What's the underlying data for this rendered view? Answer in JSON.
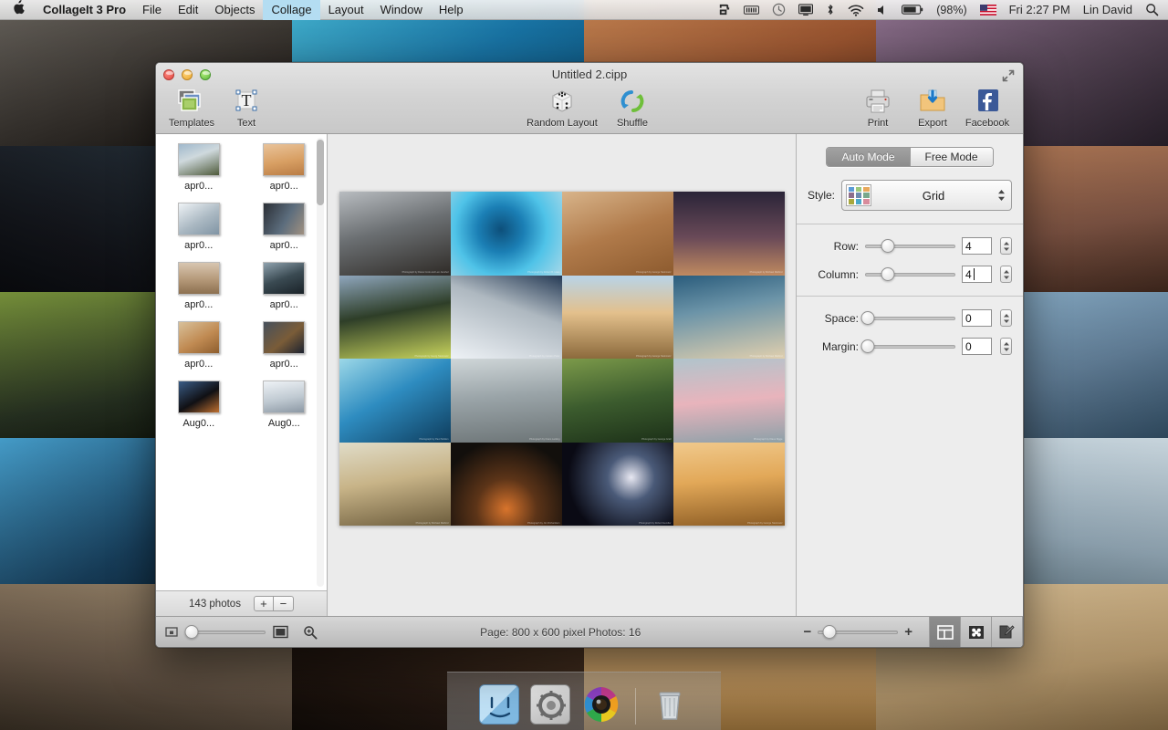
{
  "menubar": {
    "apple_icon": "apple-logo-icon",
    "app_name": "CollageIt 3 Pro",
    "menus": [
      {
        "label": "File",
        "active": false
      },
      {
        "label": "Edit",
        "active": false
      },
      {
        "label": "Objects",
        "active": false
      },
      {
        "label": "Collage",
        "active": true
      },
      {
        "label": "Layout",
        "active": false
      },
      {
        "label": "Window",
        "active": false
      },
      {
        "label": "Help",
        "active": false
      }
    ],
    "status": {
      "icons": [
        "dropbox-icon",
        "battery-pack-icon",
        "time-machine-icon",
        "display-icon",
        "bluetooth-icon",
        "wifi-icon",
        "volume-icon",
        "battery-icon"
      ],
      "battery_percent": "(98%)",
      "input_flag": "us-flag-icon",
      "clock": "Fri 2:27 PM",
      "user": "Lin David",
      "search_icon": "spotlight-search-icon"
    }
  },
  "window": {
    "title": "Untitled 2.cipp",
    "traffic": {
      "close": "close-button",
      "minimize": "minimize-button",
      "zoom": "zoom-button"
    },
    "fullscreen_icon": "fullscreen-icon"
  },
  "toolbar": {
    "left": [
      {
        "label": "Templates",
        "icon": "templates-icon"
      },
      {
        "label": "Text",
        "icon": "text-icon"
      }
    ],
    "center": [
      {
        "label": "Random Layout",
        "icon": "dice-icon"
      },
      {
        "label": "Shuffle",
        "icon": "shuffle-icon"
      }
    ],
    "right": [
      {
        "label": "Print",
        "icon": "printer-icon"
      },
      {
        "label": "Export",
        "icon": "export-folder-icon"
      },
      {
        "label": "Facebook",
        "icon": "facebook-icon"
      }
    ]
  },
  "photo_list": {
    "thumbnails": [
      {
        "name": "apr0...",
        "colors": [
          "#6d8fb0",
          "#cfd9dd",
          "#4e5a3a"
        ]
      },
      {
        "name": "apr0...",
        "colors": [
          "#e9c39a",
          "#d89f63",
          "#b97c45"
        ]
      },
      {
        "name": "apr0...",
        "colors": [
          "#d7dee3",
          "#aab8c2",
          "#8094a4"
        ]
      },
      {
        "name": "apr0...",
        "colors": [
          "#2b2f36",
          "#5c6d7d",
          "#a09080"
        ]
      },
      {
        "name": "apr0...",
        "colors": [
          "#d8c6b0",
          "#b49878",
          "#8c7050"
        ]
      },
      {
        "name": "apr0...",
        "colors": [
          "#2e3a44",
          "#6b7c86",
          "#3a4a52"
        ]
      },
      {
        "name": "apr0...",
        "colors": [
          "#c08a52",
          "#8e5e2e",
          "#d8c09a"
        ]
      },
      {
        "name": "apr0...",
        "colors": [
          "#1c2230",
          "#7a5c38",
          "#46505c"
        ]
      },
      {
        "name": "Aug0...",
        "colors": [
          "#101014",
          "#3a5c86",
          "#c07030"
        ]
      },
      {
        "name": "Aug0...",
        "colors": [
          "#d8dde2",
          "#aab4bc",
          "#8c98a4"
        ]
      }
    ],
    "count_label": "143 photos",
    "add_button": "+",
    "remove_button": "−"
  },
  "collage": {
    "cells": [
      {
        "caption": "Photograph by Diane Cook and Len Jenshel",
        "colors": [
          "#6b6f72",
          "#2e2a26",
          "#b8bcc0"
        ]
      },
      {
        "caption": "Photograph by Robert B. Haas",
        "colors": [
          "#1b7fb5",
          "#4fc3e8",
          "#a8d8e8"
        ]
      },
      {
        "caption": "Photograph by George Steinmetz",
        "colors": [
          "#b07a4a",
          "#8c5a2e",
          "#d8b48a"
        ]
      },
      {
        "caption": "Photograph by Michael Melford",
        "colors": [
          "#2a2438",
          "#6a4a58",
          "#c08a60"
        ]
      },
      {
        "caption": "Photograph by Georg Steinmetz",
        "colors": [
          "#2e3e28",
          "#9cb23a",
          "#c8d45c"
        ]
      },
      {
        "caption": "Photograph by Carsten Peter",
        "colors": [
          "#dde3e8",
          "#aeb8c0",
          "#808a94"
        ]
      },
      {
        "caption": "Photograph by George Steinmetz",
        "colors": [
          "#e3c08c",
          "#c89a62",
          "#8c6a3c"
        ]
      },
      {
        "caption": "Photograph by Michael Melford",
        "colors": [
          "#2a5c7c",
          "#b08a5a",
          "#e0cfae"
        ]
      },
      {
        "caption": "Photograph by Paul Nicklen",
        "colors": [
          "#0e3c5c",
          "#2e8cc0",
          "#9cd8e8"
        ]
      },
      {
        "caption": "Photograph by Frans Lanting",
        "colors": [
          "#9aa4a8",
          "#6c7476",
          "#d8d0c0"
        ]
      },
      {
        "caption": "Photograph by George Grall",
        "colors": [
          "#3c5c2e",
          "#1c3018",
          "#7c9a4a"
        ]
      },
      {
        "caption": "Photograph by Klaus Nigge",
        "colors": [
          "#b0c4cc",
          "#e8b4bc",
          "#8ca0a8"
        ]
      },
      {
        "caption": "Photograph by Michael Melford",
        "colors": [
          "#c8b488",
          "#9a8458",
          "#6c5c3c"
        ]
      },
      {
        "caption": "Photograph by Jim Richardson",
        "colors": [
          "#120f0c",
          "#d8742c",
          "#3c2a1c"
        ]
      },
      {
        "caption": "Photograph by Robert Gendler",
        "colors": [
          "#0a0a14",
          "#dcdce8",
          "#4a5a78"
        ]
      },
      {
        "caption": "Photograph by George Steinmetz",
        "colors": [
          "#e2a858",
          "#c88a3a",
          "#8c5c24"
        ]
      }
    ]
  },
  "inspector": {
    "modes": [
      {
        "label": "Auto Mode",
        "selected": true
      },
      {
        "label": "Free Mode",
        "selected": false
      }
    ],
    "style": {
      "label": "Style:",
      "value": "Grid",
      "swatch_icon": "grid-style-swatch-icon",
      "swatch_colors": [
        "#5b9bd5",
        "#9bc87a",
        "#e8a85c",
        "#8c6e8c",
        "#6e8cae",
        "#7aa88c",
        "#a8a83c",
        "#4aa8c8",
        "#d88c9c"
      ]
    },
    "grid_controls": [
      {
        "label": "Row:",
        "value": "4",
        "slider_pct": 25,
        "focused": false
      },
      {
        "label": "Column:",
        "value": "4",
        "slider_pct": 25,
        "focused": true
      }
    ],
    "spacing_controls": [
      {
        "label": "Space:",
        "value": "0",
        "slider_pct": 0,
        "focused": false
      },
      {
        "label": "Margin:",
        "value": "0",
        "slider_pct": 0,
        "focused": false
      }
    ]
  },
  "statusbar": {
    "small_thumb_icon": "small-thumbnail-icon",
    "large_thumb_icon": "large-thumbnail-icon",
    "magnify_icon": "magnifier-icon",
    "thumb_slider_pct": 6,
    "page_info": "Page: 800 x 600 pixel Photos: 16",
    "zoom_minus": "−",
    "zoom_plus": "+",
    "zoom_slider_pct": 12,
    "view_modes": [
      {
        "icon": "layout-panel-icon",
        "selected": true
      },
      {
        "icon": "photos-panel-icon",
        "selected": false
      },
      {
        "icon": "edit-panel-icon",
        "selected": false
      }
    ]
  },
  "dock": {
    "items": [
      {
        "name": "finder-icon"
      },
      {
        "name": "system-preferences-icon"
      },
      {
        "name": "collageit-icon"
      },
      {
        "name": "trash-icon"
      }
    ]
  },
  "wallpaper": {
    "columns": [
      [
        "#3a3530",
        "#14161c",
        "#2c3826",
        "#1c4a6c",
        "#6b5a4a"
      ],
      [
        "#1b7fb5",
        "#2a3a46",
        "#cfd4d8",
        "#b8a888",
        "#2a1c14"
      ],
      [
        "#a85c34",
        "#b8743c",
        "#d8a868",
        "#c89a5c",
        "#e0b070"
      ],
      [
        "#5c4a5c",
        "#8a5c4a",
        "#6c8ca8",
        "#a8c0d0",
        "#c8a878"
      ]
    ]
  }
}
